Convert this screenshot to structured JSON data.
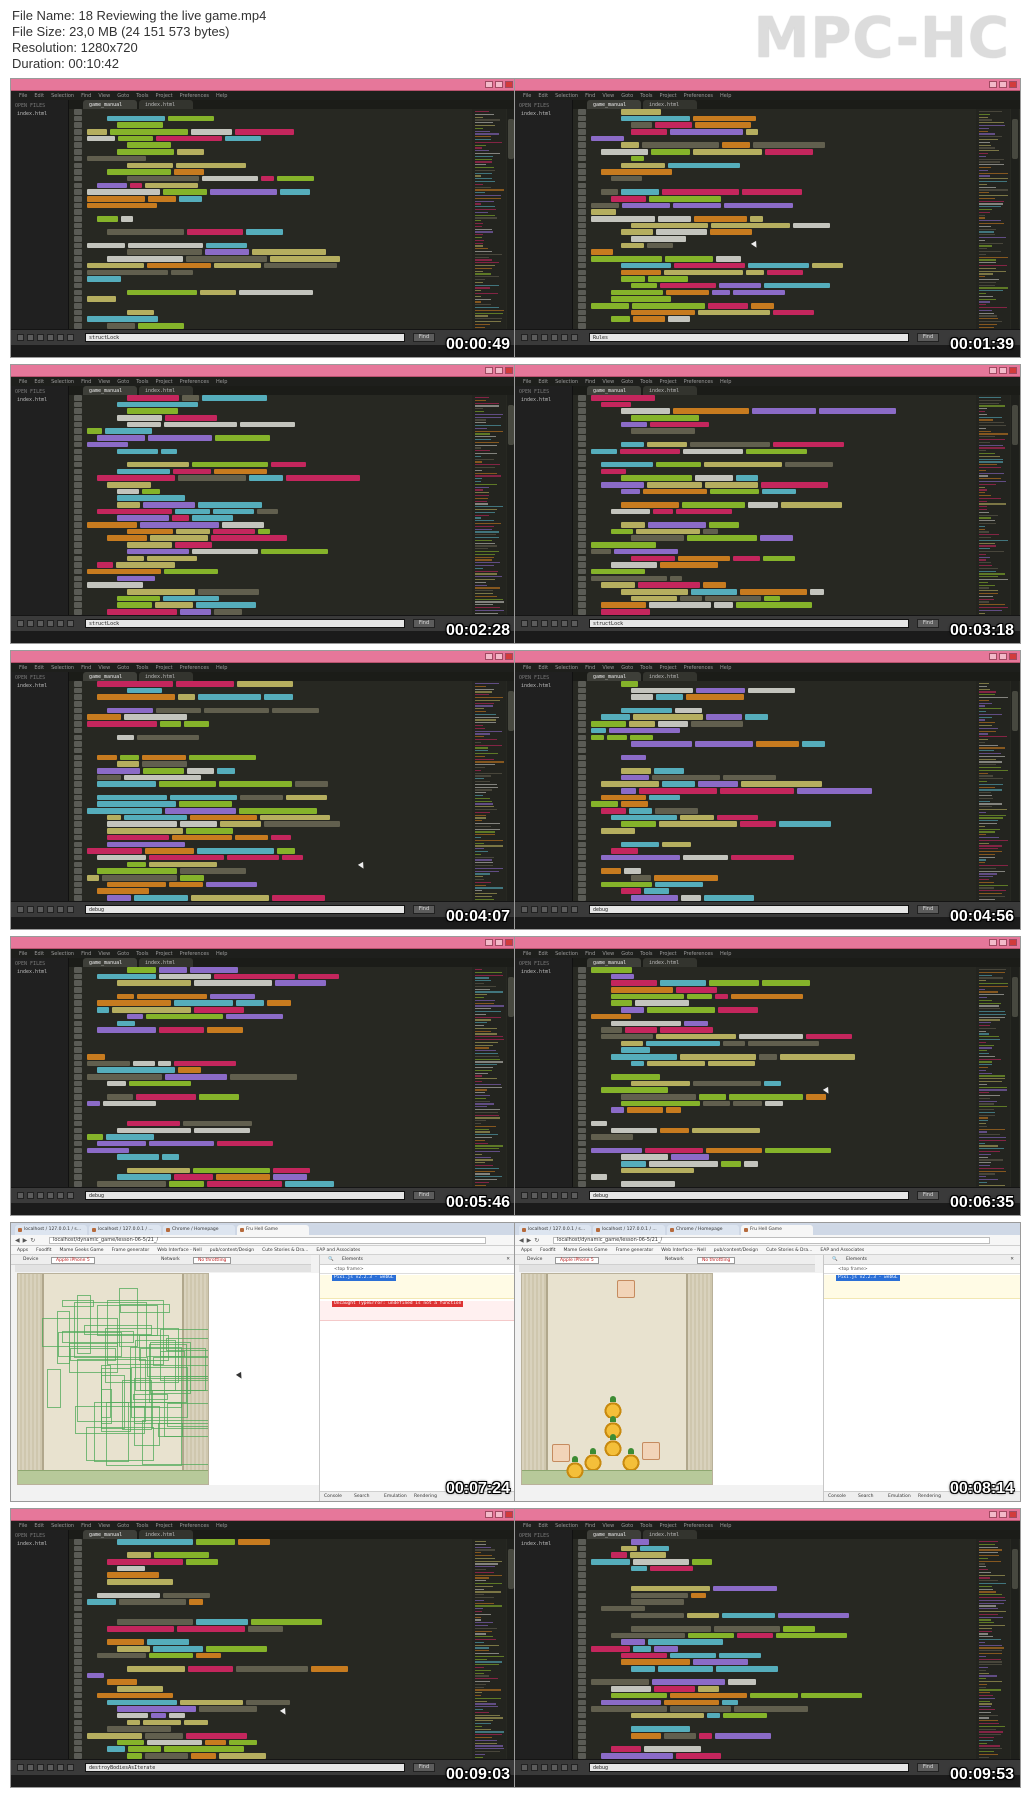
{
  "header": {
    "lines": [
      "File Name: 18 Reviewing the live game.mp4",
      "File Size: 23,0 MB (24 151 573 bytes)",
      "Resolution: 1280x720",
      "Duration: 00:10:42"
    ],
    "logo": "MPC-HC"
  },
  "colors": {
    "editor_bg": "#272822",
    "titlebar": "#e6779a",
    "timestamp": "#ffffff"
  },
  "editor": {
    "menu": [
      "File",
      "Edit",
      "Selection",
      "Find",
      "View",
      "Goto",
      "Tools",
      "Project",
      "Preferences",
      "Help"
    ],
    "sidebar_label": "OPEN FILES",
    "tabs": [
      "game_manual",
      "index.html"
    ]
  },
  "thumbnails": [
    {
      "type": "editor",
      "timestamp": "00:00:49",
      "find": "structLock"
    },
    {
      "type": "editor",
      "timestamp": "00:01:39",
      "find": "Rules"
    },
    {
      "type": "editor",
      "timestamp": "00:02:28",
      "find": "structLock"
    },
    {
      "type": "editor",
      "timestamp": "00:03:18",
      "find": "structLock"
    },
    {
      "type": "editor",
      "timestamp": "00:04:07",
      "find": "debug"
    },
    {
      "type": "editor",
      "timestamp": "00:04:56",
      "find": "debug"
    },
    {
      "type": "editor",
      "timestamp": "00:05:46",
      "find": "debug"
    },
    {
      "type": "editor",
      "timestamp": "00:06:35",
      "find": "debug"
    },
    {
      "type": "browser",
      "timestamp": "00:07:24",
      "tabs": [
        "localhost / 127.0.0.1 / s...",
        "localhost / 127.0.0.1 / ...",
        "Chrome / Homepage",
        "Fru Hell Game"
      ],
      "url": "localhost/dynamic_game/lesson-06-5/21_/",
      "bookmarks": [
        "Apps",
        "Foodfit",
        "Mame Geeks Game",
        "Frame generator",
        "Web Interface - Nell",
        "pub/content/Design",
        "Cute Stories & Dra...",
        "EAP and Associates"
      ],
      "device": "Device",
      "device_value": "Apple iPhone 5",
      "network": "Network",
      "network_value": "No throttling",
      "console_tab": "Elements",
      "messages": [
        {
          "kind": "warn",
          "text": "Pixi.js v2.2.3 - webGL"
        },
        {
          "kind": "err",
          "text": "Uncaught TypeError: undefined is not a function"
        }
      ],
      "console_tabs": [
        "Console",
        "Search",
        "Emulation",
        "Rendering"
      ]
    },
    {
      "type": "browser",
      "timestamp": "00:08:14",
      "tabs": [
        "localhost / 127.0.0.1 / s...",
        "localhost / 127.0.0.1 / ...",
        "Chrome / Homepage",
        "Fru Hell Game"
      ],
      "url": "localhost/dynamic_game/lesson-06-5/21_/",
      "bookmarks": [
        "Apps",
        "Foodfit",
        "Mame Geeks Game",
        "Frame generator",
        "Web Interface - Nell",
        "pub/content/Design",
        "Cute Stories & Dra...",
        "EAP and Associates"
      ],
      "device": "Device",
      "device_value": "Apple iPhone 5",
      "network": "Network",
      "network_value": "No throttling",
      "console_tab": "Elements",
      "messages": [
        {
          "kind": "warn",
          "text": "Pixi.js v2.2.3 - webGL"
        }
      ],
      "console_tabs": [
        "Console",
        "Search",
        "Emulation",
        "Rendering"
      ]
    },
    {
      "type": "editor",
      "timestamp": "00:09:03",
      "find": "destroyBodiesAsIterate"
    },
    {
      "type": "editor",
      "timestamp": "00:09:53",
      "find": "debug"
    }
  ]
}
